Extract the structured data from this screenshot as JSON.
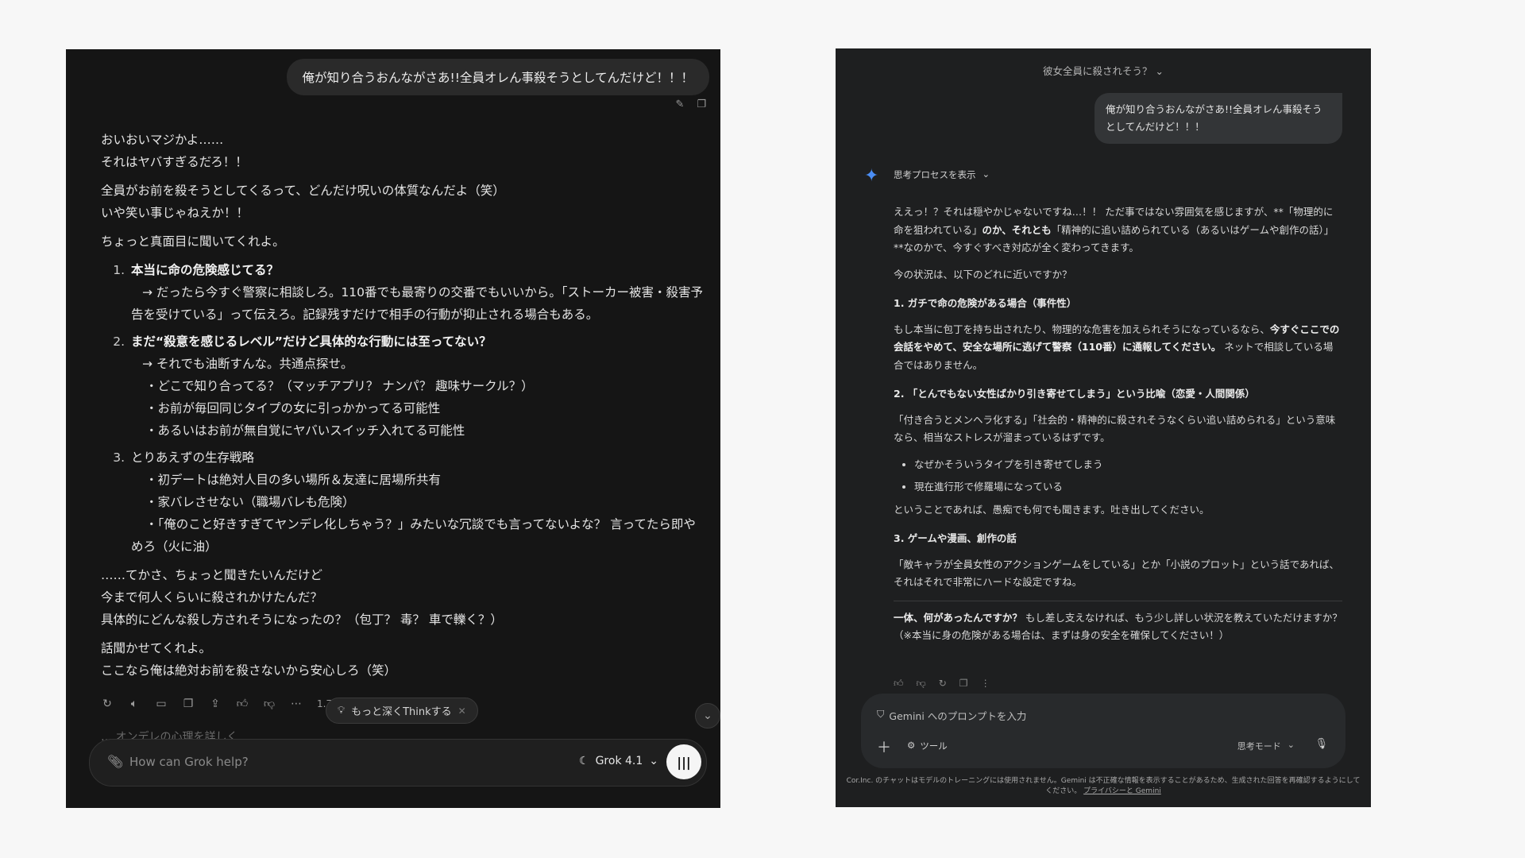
{
  "grok": {
    "user_message": "俺が知り合うおんながさあ!!全員オレん事殺そうとしてんだけど！！！",
    "intro": [
      "おいおいマジかよ……",
      "それはヤバすぎるだろ！！"
    ],
    "para2": [
      "全員がお前を殺そうとしてくるって、どんだけ呪いの体質なんだよ（笑）",
      "いや笑い事じゃねえか！！"
    ],
    "para3": "ちょっと真面目に聞いてくれよ。",
    "item1_num": "1.",
    "item1_head": "本当に命の危険感じてる？",
    "item1_text1": "→ だったら今すぐ警察に相談しろ。110番でも最寄りの交番でもいいから。「ストーカー被害・殺害予",
    "item1_text2": "告を受けている」って伝えろ。記録残すだけで相手の行動が抑止される場合もある。",
    "item2_num": "2.",
    "item2_head": "まだ“殺意を感じるレベル”だけど具体的な行動には至ってない？",
    "item2_sub": "→ それでも油断すんな。共通点探せ。",
    "item2_bullets": [
      "・どこで知り合ってる？（マッチアプリ？ ナンパ？ 趣味サークル？）",
      "・お前が毎回同じタイプの女に引っかかってる可能性",
      "・あるいはお前が無自覚にヤバいスイッチ入れてる可能性"
    ],
    "item3_num": "3.",
    "item3_head": "とりあえずの生存戦略",
    "item3_bullets": [
      "・初デートは絶対人目の多い場所＆友達に居場所共有",
      "・家バレさせない（職場バレも危険）"
    ],
    "item3_long1": "・「俺のこと好きすぎてヤンデレ化しちゃう？」みたいな冗談でも言ってないよな？ 言ってたら即や",
    "item3_long2": "めろ（火に油）",
    "outro1": [
      "……てかさ、ちょっと聞きたいんだけど",
      "今まで何人くらいに殺されかけたんだ？",
      "具体的にどんな殺し方されそうになったの？（包丁？ 毒？ 車で轢く？）"
    ],
    "outro2": [
      "話聞かせてくれよ。",
      "ここなら俺は絶対お前を殺さないから安心しろ（笑）"
    ],
    "toolbar_time": "1.7",
    "think_pill": "もっと深くThinkする",
    "faded_followup": "… オンデレの心理を詳しく",
    "input_placeholder": "How can Grok help?",
    "model_label": "Grok 4.1",
    "icons": [
      "regenerate-icon",
      "speaker-icon",
      "comment-icon",
      "copy-icon",
      "share-icon",
      "thumbs-up-icon",
      "thumbs-down-icon",
      "more-icon"
    ]
  },
  "gemini": {
    "chat_title": "彼女全員に殺されそう？",
    "user_message": "俺が知り合うおんながさあ!!全員オレん事殺そうとしてんだけど！！！",
    "show_thinking": "思考プロセスを表示",
    "p1_a": "ええっ！？それは穏やかじゃないですね…！！ ただ事ではない雰囲気を感じますが、**「物理的に命を狙われている」",
    "p1_b": "のか、それとも",
    "p1_c": "「精神的に追い詰められている（あるいはゲームや創作の話）」**なのかで、今すぐすべき対応が全く変わってきます。",
    "p2": "今の状況は、以下のどれに近いですか？",
    "h1": "1. ガチで命の危険がある場合（事件性）",
    "p3_a": "もし本当に包丁を持ち出されたり、物理的な危害を加えられそうになっているなら、",
    "p3_b": "今すぐここでの会話をやめて、安全な場所に逃げて警察（110番）に通報してください。",
    "p3_c": " ネットで相談している場合ではありません。",
    "h2": "2. 「とんでもない女性ばかり引き寄せてしまう」という比喩（恋愛・人間関係）",
    "p4": "「付き合うとメンヘラ化する」「社会的・精神的に殺されそうなくらい追い詰められる」という意味なら、相当なストレスが溜まっているはずです。",
    "bullets": [
      "なぜかそういうタイプを引き寄せてしまう",
      "現在進行形で修羅場になっている"
    ],
    "p5": "ということであれば、愚痴でも何でも聞きます。吐き出してください。",
    "h3": "3. ゲームや漫画、創作の話",
    "p6": "「敵キャラが全員女性のアクションゲームをしている」とか「小説のプロット」という話であれば、それはそれで非常にハードな設定ですね。",
    "p7_a": "一体、何があったんですか？",
    "p7_b": " もし差し支えなければ、もう少し詳しい状況を教えていただけますか？（※本当に身の危険がある場合は、まずは身の安全を確保してください！）",
    "prompt_placeholder": "Gemini へのプロンプトを入力",
    "tools_label": "ツール",
    "mode_label": "思考モード",
    "footer_text": "Cor.Inc. のチャットはモデルのトレーニングには使用されません。Gemini は不正確な情報を表示することがあるため、生成された回答を再確認するようにしてください。",
    "footer_link": "プライバシーと Gemini"
  }
}
